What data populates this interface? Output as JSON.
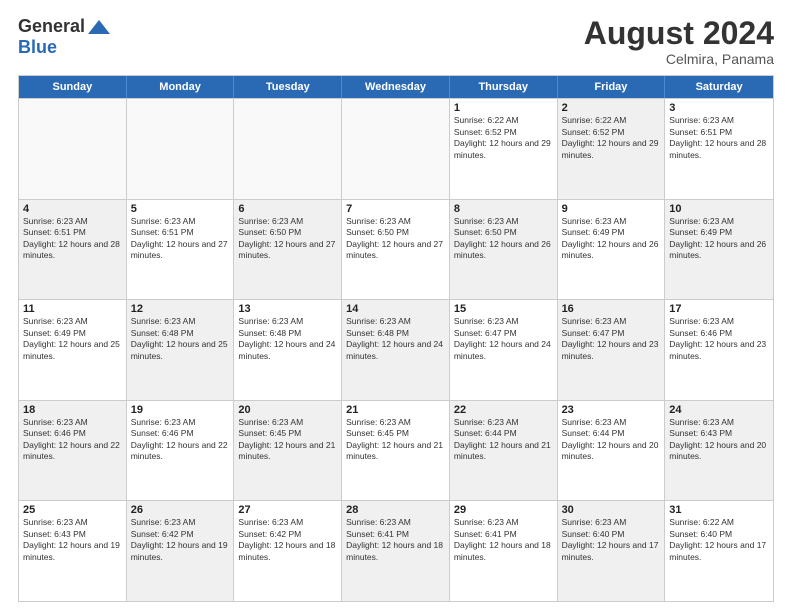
{
  "header": {
    "logo_general": "General",
    "logo_blue": "Blue",
    "main_title": "August 2024",
    "subtitle": "Celmira, Panama"
  },
  "calendar": {
    "days_of_week": [
      "Sunday",
      "Monday",
      "Tuesday",
      "Wednesday",
      "Thursday",
      "Friday",
      "Saturday"
    ],
    "rows": [
      [
        {
          "day": "",
          "empty": true,
          "shaded": false
        },
        {
          "day": "",
          "empty": true,
          "shaded": false
        },
        {
          "day": "",
          "empty": true,
          "shaded": false
        },
        {
          "day": "",
          "empty": true,
          "shaded": false
        },
        {
          "day": "1",
          "empty": false,
          "shaded": false,
          "sunrise": "6:22 AM",
          "sunset": "6:52 PM",
          "daylight": "12 hours and 29 minutes."
        },
        {
          "day": "2",
          "empty": false,
          "shaded": true,
          "sunrise": "6:22 AM",
          "sunset": "6:52 PM",
          "daylight": "12 hours and 29 minutes."
        },
        {
          "day": "3",
          "empty": false,
          "shaded": false,
          "sunrise": "6:23 AM",
          "sunset": "6:51 PM",
          "daylight": "12 hours and 28 minutes."
        }
      ],
      [
        {
          "day": "4",
          "empty": false,
          "shaded": true,
          "sunrise": "6:23 AM",
          "sunset": "6:51 PM",
          "daylight": "12 hours and 28 minutes."
        },
        {
          "day": "5",
          "empty": false,
          "shaded": false,
          "sunrise": "6:23 AM",
          "sunset": "6:51 PM",
          "daylight": "12 hours and 27 minutes."
        },
        {
          "day": "6",
          "empty": false,
          "shaded": true,
          "sunrise": "6:23 AM",
          "sunset": "6:50 PM",
          "daylight": "12 hours and 27 minutes."
        },
        {
          "day": "7",
          "empty": false,
          "shaded": false,
          "sunrise": "6:23 AM",
          "sunset": "6:50 PM",
          "daylight": "12 hours and 27 minutes."
        },
        {
          "day": "8",
          "empty": false,
          "shaded": true,
          "sunrise": "6:23 AM",
          "sunset": "6:50 PM",
          "daylight": "12 hours and 26 minutes."
        },
        {
          "day": "9",
          "empty": false,
          "shaded": false,
          "sunrise": "6:23 AM",
          "sunset": "6:49 PM",
          "daylight": "12 hours and 26 minutes."
        },
        {
          "day": "10",
          "empty": false,
          "shaded": true,
          "sunrise": "6:23 AM",
          "sunset": "6:49 PM",
          "daylight": "12 hours and 26 minutes."
        }
      ],
      [
        {
          "day": "11",
          "empty": false,
          "shaded": false,
          "sunrise": "6:23 AM",
          "sunset": "6:49 PM",
          "daylight": "12 hours and 25 minutes."
        },
        {
          "day": "12",
          "empty": false,
          "shaded": true,
          "sunrise": "6:23 AM",
          "sunset": "6:48 PM",
          "daylight": "12 hours and 25 minutes."
        },
        {
          "day": "13",
          "empty": false,
          "shaded": false,
          "sunrise": "6:23 AM",
          "sunset": "6:48 PM",
          "daylight": "12 hours and 24 minutes."
        },
        {
          "day": "14",
          "empty": false,
          "shaded": true,
          "sunrise": "6:23 AM",
          "sunset": "6:48 PM",
          "daylight": "12 hours and 24 minutes."
        },
        {
          "day": "15",
          "empty": false,
          "shaded": false,
          "sunrise": "6:23 AM",
          "sunset": "6:47 PM",
          "daylight": "12 hours and 24 minutes."
        },
        {
          "day": "16",
          "empty": false,
          "shaded": true,
          "sunrise": "6:23 AM",
          "sunset": "6:47 PM",
          "daylight": "12 hours and 23 minutes."
        },
        {
          "day": "17",
          "empty": false,
          "shaded": false,
          "sunrise": "6:23 AM",
          "sunset": "6:46 PM",
          "daylight": "12 hours and 23 minutes."
        }
      ],
      [
        {
          "day": "18",
          "empty": false,
          "shaded": true,
          "sunrise": "6:23 AM",
          "sunset": "6:46 PM",
          "daylight": "12 hours and 22 minutes."
        },
        {
          "day": "19",
          "empty": false,
          "shaded": false,
          "sunrise": "6:23 AM",
          "sunset": "6:46 PM",
          "daylight": "12 hours and 22 minutes."
        },
        {
          "day": "20",
          "empty": false,
          "shaded": true,
          "sunrise": "6:23 AM",
          "sunset": "6:45 PM",
          "daylight": "12 hours and 21 minutes."
        },
        {
          "day": "21",
          "empty": false,
          "shaded": false,
          "sunrise": "6:23 AM",
          "sunset": "6:45 PM",
          "daylight": "12 hours and 21 minutes."
        },
        {
          "day": "22",
          "empty": false,
          "shaded": true,
          "sunrise": "6:23 AM",
          "sunset": "6:44 PM",
          "daylight": "12 hours and 21 minutes."
        },
        {
          "day": "23",
          "empty": false,
          "shaded": false,
          "sunrise": "6:23 AM",
          "sunset": "6:44 PM",
          "daylight": "12 hours and 20 minutes."
        },
        {
          "day": "24",
          "empty": false,
          "shaded": true,
          "sunrise": "6:23 AM",
          "sunset": "6:43 PM",
          "daylight": "12 hours and 20 minutes."
        }
      ],
      [
        {
          "day": "25",
          "empty": false,
          "shaded": false,
          "sunrise": "6:23 AM",
          "sunset": "6:43 PM",
          "daylight": "12 hours and 19 minutes."
        },
        {
          "day": "26",
          "empty": false,
          "shaded": true,
          "sunrise": "6:23 AM",
          "sunset": "6:42 PM",
          "daylight": "12 hours and 19 minutes."
        },
        {
          "day": "27",
          "empty": false,
          "shaded": false,
          "sunrise": "6:23 AM",
          "sunset": "6:42 PM",
          "daylight": "12 hours and 18 minutes."
        },
        {
          "day": "28",
          "empty": false,
          "shaded": true,
          "sunrise": "6:23 AM",
          "sunset": "6:41 PM",
          "daylight": "12 hours and 18 minutes."
        },
        {
          "day": "29",
          "empty": false,
          "shaded": false,
          "sunrise": "6:23 AM",
          "sunset": "6:41 PM",
          "daylight": "12 hours and 18 minutes."
        },
        {
          "day": "30",
          "empty": false,
          "shaded": true,
          "sunrise": "6:23 AM",
          "sunset": "6:40 PM",
          "daylight": "12 hours and 17 minutes."
        },
        {
          "day": "31",
          "empty": false,
          "shaded": false,
          "sunrise": "6:22 AM",
          "sunset": "6:40 PM",
          "daylight": "12 hours and 17 minutes."
        }
      ]
    ]
  }
}
